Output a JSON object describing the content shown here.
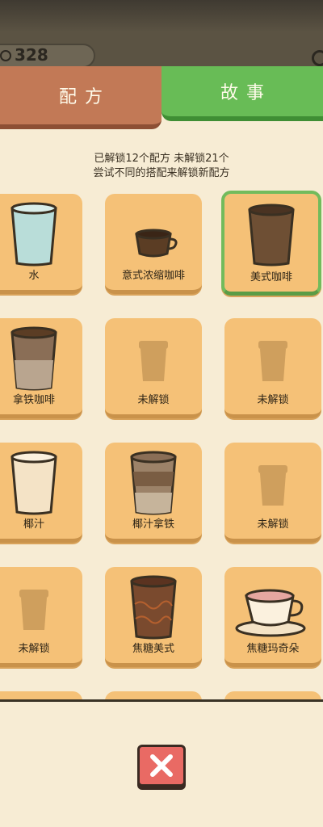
{
  "header": {
    "coins": "328"
  },
  "tabs": {
    "recipes": "配方",
    "story": "故事"
  },
  "summary": {
    "line1": "已解锁12个配方 未解锁21个",
    "line2": "尝试不同的搭配来解锁新配方"
  },
  "recipes": [
    {
      "label": "水",
      "icon": "water-cup-icon"
    },
    {
      "label": "意式浓缩咖啡",
      "icon": "espresso-cup-icon"
    },
    {
      "label": "美式咖啡",
      "icon": "americano-cup-icon",
      "selected": true
    },
    {
      "label": "拿铁咖啡",
      "icon": "latte-cup-icon"
    },
    {
      "label": "未解锁",
      "icon": "locked-cup-icon"
    },
    {
      "label": "未解锁",
      "icon": "locked-cup-icon"
    },
    {
      "label": "椰汁",
      "icon": "coconut-milk-cup-icon"
    },
    {
      "label": "椰汁拿铁",
      "icon": "coconut-latte-cup-icon"
    },
    {
      "label": "未解锁",
      "icon": "locked-cup-icon"
    },
    {
      "label": "未解锁",
      "icon": "locked-cup-icon"
    },
    {
      "label": "焦糖美式",
      "icon": "caramel-americano-cup-icon"
    },
    {
      "label": "焦糖玛奇朵",
      "icon": "caramel-macchiato-cup-icon"
    }
  ],
  "colors": {
    "background": "#f7ecd4",
    "card": "#f5c177",
    "recipes_tab": "#c27956",
    "story_tab": "#68bc56",
    "selected_border": "#72bb5c",
    "close_button": "#e96a64"
  }
}
